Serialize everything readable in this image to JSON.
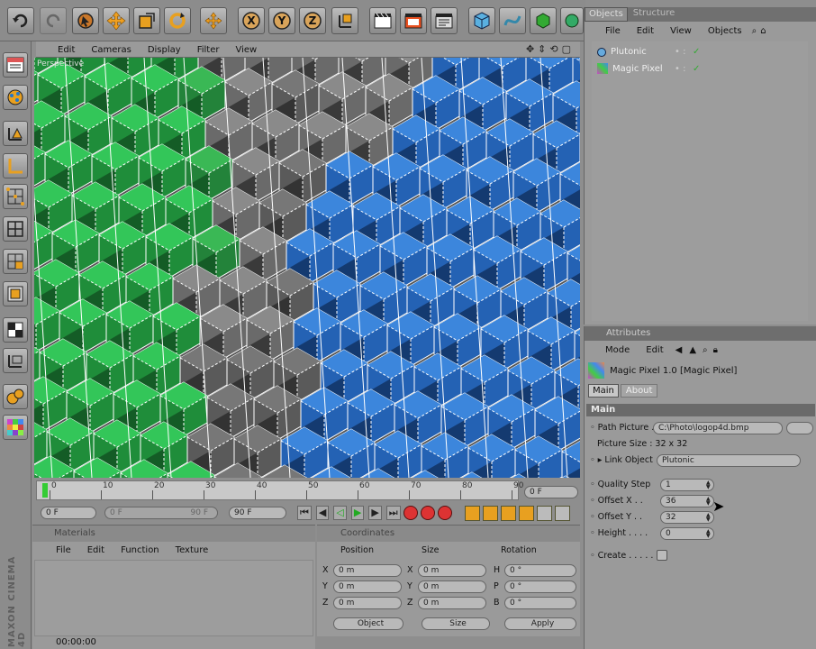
{
  "toolbar": {
    "icons": [
      "undo-icon",
      "redo-icon",
      "live-select-icon",
      "move-icon",
      "scale-icon",
      "rotate-icon",
      "move-icon",
      "x-axis-icon",
      "y-axis-icon",
      "z-axis-icon",
      "coordinate-system-icon",
      "render-view-icon",
      "render-picture-viewer-icon",
      "render-settings-icon",
      "cube-icon",
      "spline-icon",
      "nurbs-icon",
      "array-icon"
    ],
    "x_label": "X",
    "y_label": "Y",
    "z_label": "Z"
  },
  "viewport": {
    "menu": [
      "Edit",
      "Cameras",
      "Display",
      "Filter",
      "View"
    ],
    "label": "Perspective"
  },
  "timeline": {
    "ticks": [
      "0",
      "10",
      "20",
      "30",
      "40",
      "50",
      "60",
      "70",
      "80",
      "90"
    ],
    "frame_value": "0 F",
    "start": "0 F",
    "range_start": "0 F",
    "range_end": "90 F",
    "end": "90 F"
  },
  "materials": {
    "title": "Materials",
    "menu": [
      "File",
      "Edit",
      "Function",
      "Texture"
    ]
  },
  "coordinates": {
    "title": "Coordinates",
    "headers": [
      "Position",
      "Size",
      "Rotation"
    ],
    "rows": [
      {
        "pl": "X",
        "pv": "0 m",
        "sl": "X",
        "sv": "0 m",
        "rl": "H",
        "rv": "0 °"
      },
      {
        "pl": "Y",
        "pv": "0 m",
        "sl": "Y",
        "sv": "0 m",
        "rl": "P",
        "rv": "0 °"
      },
      {
        "pl": "Z",
        "pv": "0 m",
        "sl": "Z",
        "sv": "0 m",
        "rl": "B",
        "rv": "0 °"
      }
    ],
    "mode": "Object",
    "size_mode": "Size",
    "apply": "Apply"
  },
  "objects": {
    "tabs": [
      "Objects",
      "Structure"
    ],
    "menu": [
      "File",
      "Edit",
      "View",
      "Objects"
    ],
    "items": [
      "Plutonic",
      "Magic Pixel"
    ]
  },
  "attributes": {
    "title": "Attributes",
    "menu": [
      "Mode",
      "Edit"
    ],
    "object_title": "Magic Pixel 1.0 [Magic Pixel]",
    "tabs": [
      "Main",
      "About"
    ],
    "section": "Main",
    "path_label": "Path Picture",
    "path_value": "C:\\Photo\\logop4d.bmp",
    "picture_size": "Picture Size : 32 x 32",
    "link_label": "Link Object",
    "link_value": "Plutonic",
    "quality_label": "Quality Step",
    "quality_value": "1",
    "offx_label": "Offset X",
    "offx_value": "36",
    "offy_label": "Offset Y",
    "offy_value": "32",
    "height_label": "Height",
    "height_value": "0",
    "create_label": "Create"
  },
  "status": {
    "time": "00:00:00"
  },
  "brand": "MAXON CINEMA 4D"
}
